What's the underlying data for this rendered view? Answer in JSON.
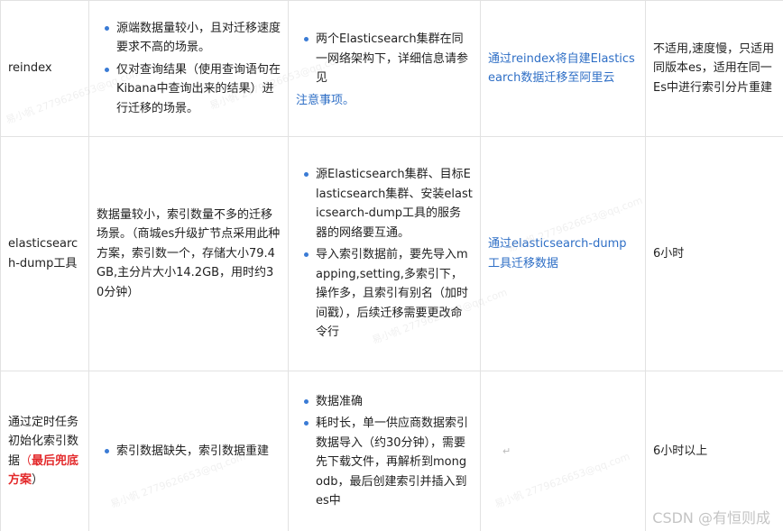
{
  "table": {
    "rows": [
      {
        "method": "reindex",
        "scenario_bullets": [
          "源端数据量较小，且对迁移速度要求不高的场景。",
          "仅对查询结果（使用查询语句在Kibana中查询出来的结果）进行迁移的场景。"
        ],
        "precondition_bullets": [
          "两个Elasticsearch集群在同一网络架构下，详细信息请参见"
        ],
        "precondition_note": "注意事项。",
        "doc_link": "通过reindex将自建Elasticsearch数据迁移至阿里云",
        "duration": "不适用,速度慢，只适用同版本es，适用在同一Es中进行索引分片重建"
      },
      {
        "method": "elasticsearch-dump工具",
        "scenario_text": "数据量较小，索引数量不多的迁移场景。（商城es升级扩节点采用此种方案，索引数一个，存储大小79.4GB,主分片大小14.2GB，用时约30分钟）",
        "precondition_bullets": [
          "源Elasticsearch集群、目标Elasticsearch集群、安装elasticsearch-dump工具的服务器的网络要互通。",
          "导入索引数据前，要先导入mapping,setting,多索引下，操作多，且索引有别名（加时间戳），后续迁移需要更改命令行"
        ],
        "doc_link": "通过elasticsearch-dump工具迁移数据",
        "duration": "6小时"
      },
      {
        "method_text": "通过定时任务初始化索引数据",
        "method_paren_open": "（",
        "method_highlight": "最后兜底方案",
        "method_paren_close": "）",
        "scenario_bullets": [
          "索引数据缺失，索引数据重建"
        ],
        "precondition_bullets": [
          "数据准确",
          "耗时长，单一供应商数据索引数据导入（约30分钟），需要先下载文件，再解析到mongodb，最后创建索引并插入到es中"
        ],
        "doc_mark": "↵",
        "duration": "6小时以上"
      }
    ]
  },
  "watermark_text": "易小帆 2779626653@qq.com",
  "footer": {
    "brand": "CSDN @有恒则成"
  }
}
